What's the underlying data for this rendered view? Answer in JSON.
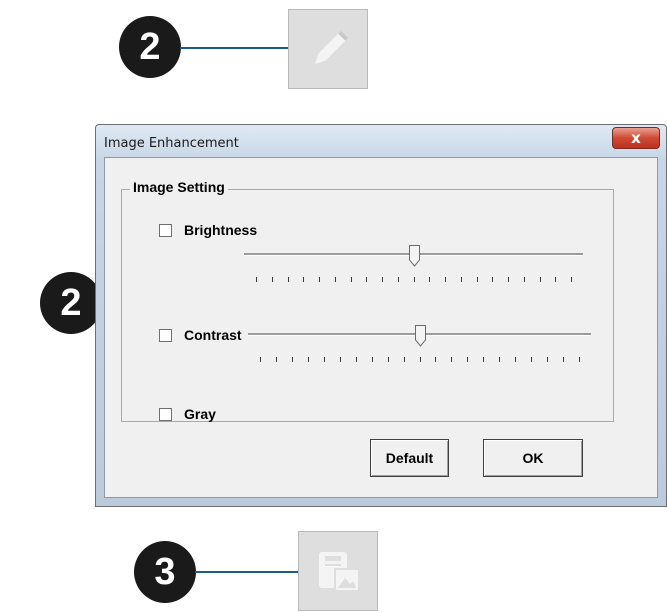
{
  "callouts": {
    "top": "2",
    "middle": "2",
    "bottom": "3"
  },
  "toolbar_icons": {
    "edit": "pencil-icon",
    "save": "save-image-icon"
  },
  "dialog": {
    "title": "Image Enhancement",
    "close_label": "x",
    "group_title": "Image Setting",
    "brightness": {
      "label": "Brightness",
      "checked": false,
      "slider_level": 0.5
    },
    "contrast": {
      "label": "Contrast",
      "checked": false,
      "slider_level": 0.5
    },
    "gray": {
      "label": "Gray",
      "checked": false
    },
    "default_label": "Default",
    "ok_label": "OK"
  },
  "colors": {
    "leader_line": "#1d5a86",
    "callout_fill": "#1a1a1a",
    "close_button": "#c94430"
  }
}
